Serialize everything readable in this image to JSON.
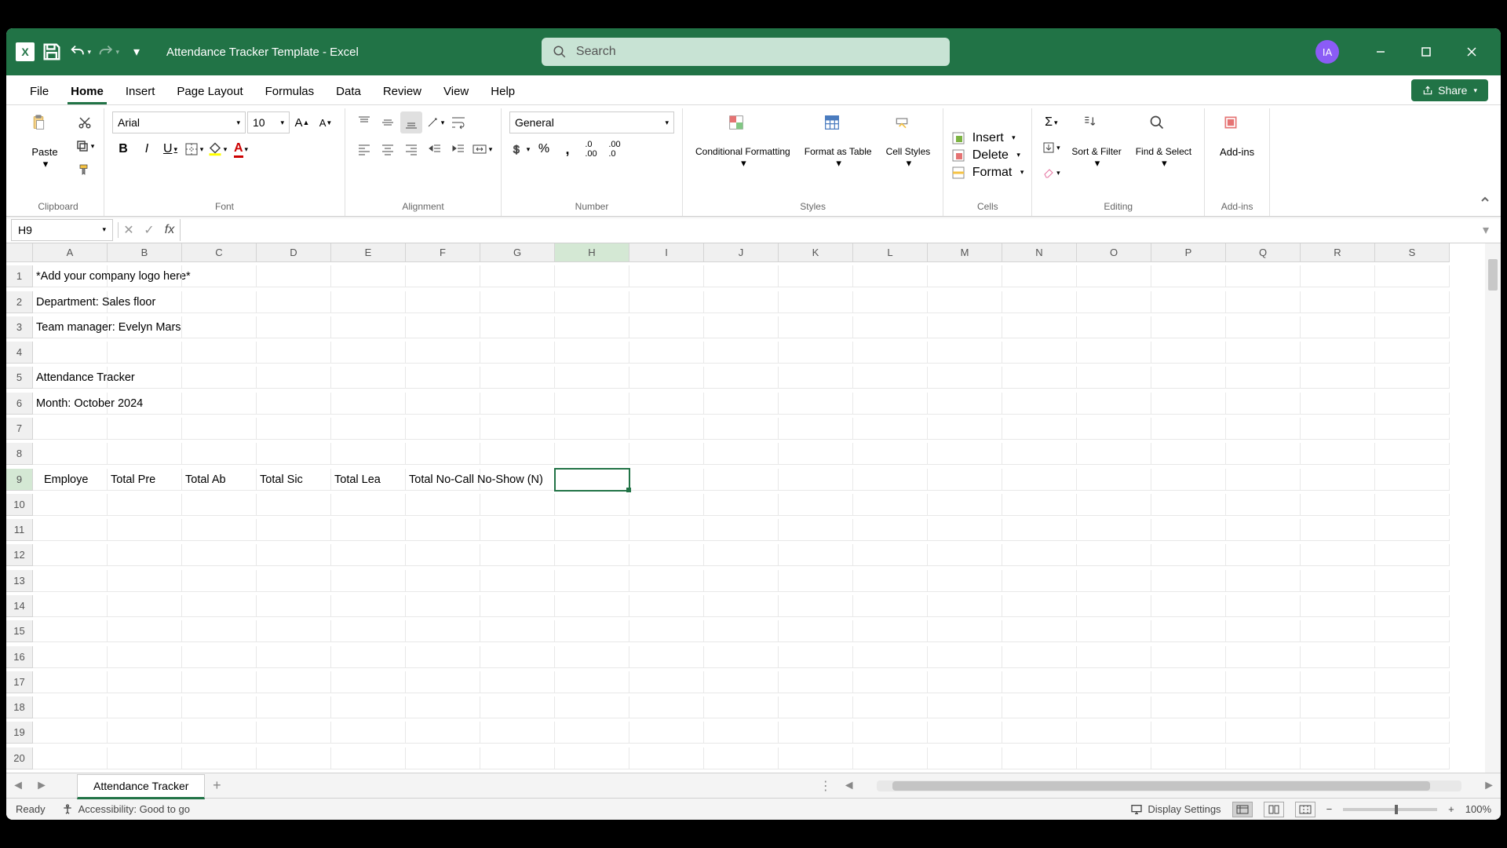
{
  "titlebar": {
    "doc_name": "Attendance Tracker Template  -  Excel",
    "search_placeholder": "Search",
    "avatar_initials": "IA"
  },
  "tabs": {
    "file": "File",
    "home": "Home",
    "insert": "Insert",
    "pagelayout": "Page Layout",
    "formulas": "Formulas",
    "data": "Data",
    "review": "Review",
    "view": "View",
    "help": "Help",
    "share": "Share"
  },
  "ribbon": {
    "clipboard": {
      "paste": "Paste",
      "label": "Clipboard"
    },
    "font": {
      "name": "Arial",
      "size": "10",
      "label": "Font"
    },
    "alignment": {
      "label": "Alignment"
    },
    "number": {
      "format": "General",
      "label": "Number"
    },
    "styles": {
      "cond": "Conditional Formatting",
      "table": "Format as Table",
      "cell": "Cell Styles",
      "label": "Styles"
    },
    "cells": {
      "insert": "Insert",
      "delete": "Delete",
      "format": "Format",
      "label": "Cells"
    },
    "editing": {
      "sort": "Sort & Filter",
      "find": "Find & Select",
      "label": "Editing"
    },
    "addins": {
      "addins": "Add-ins",
      "label": "Add-ins"
    }
  },
  "namebox": "H9",
  "columns": [
    "A",
    "B",
    "C",
    "D",
    "E",
    "F",
    "G",
    "H",
    "I",
    "J",
    "K",
    "L",
    "M",
    "N",
    "O",
    "P",
    "Q",
    "R",
    "S"
  ],
  "rows_shown": 20,
  "selected": {
    "col": "H",
    "row": 9
  },
  "cells": {
    "A1": "*Add your company logo here*",
    "A2": "Department: Sales floor",
    "A3": "Team manager: Evelyn Mars",
    "A5": "Attendance Tracker",
    "A6": "Month: October 2024",
    "A9": "Employe",
    "B9": "Total Pre",
    "C9": "Total Ab",
    "D9": "Total Sic",
    "E9": "Total Lea",
    "F9": "Total No-Call No-Show (N)"
  },
  "sheet": {
    "name": "Attendance Tracker"
  },
  "status": {
    "ready": "Ready",
    "accessibility": "Accessibility: Good to go",
    "display": "Display Settings",
    "zoom": "100%"
  }
}
